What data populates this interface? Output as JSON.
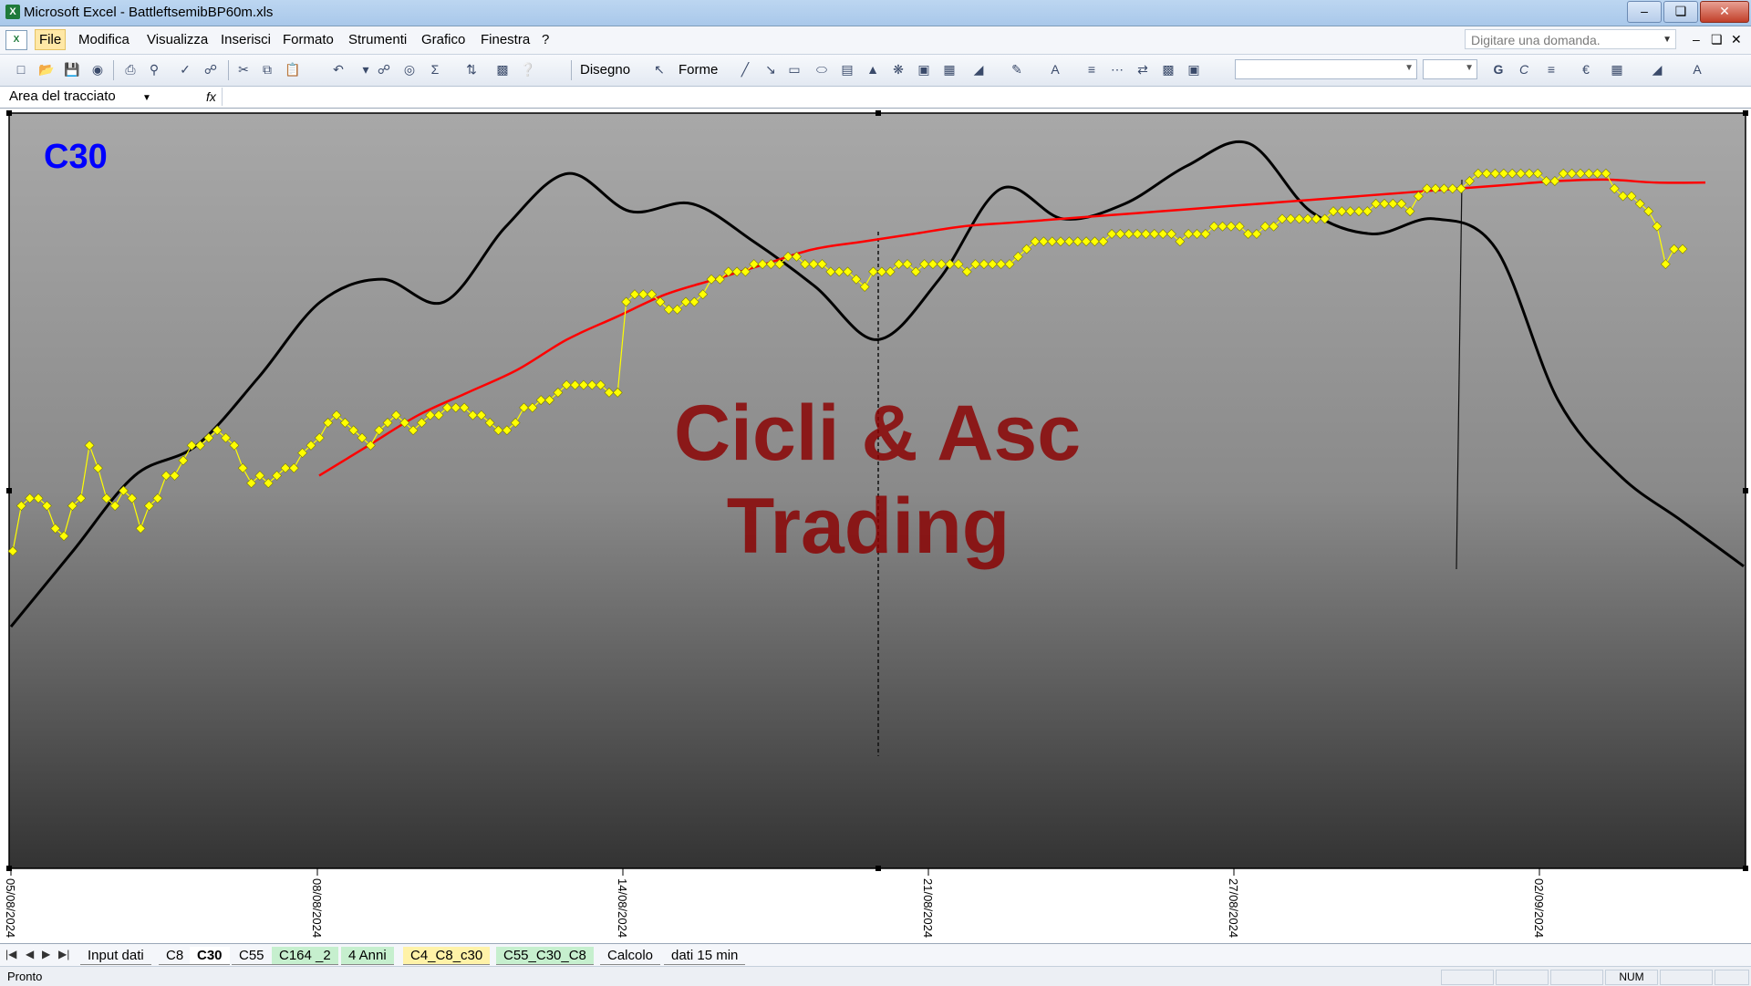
{
  "window": {
    "title": "Microsoft Excel - BattleftsemibBP60m.xls"
  },
  "menu": [
    "File",
    "Modifica",
    "Visualizza",
    "Inserisci",
    "Formato",
    "Strumenti",
    "Grafico",
    "Finestra",
    "?"
  ],
  "ask_placeholder": "Digitare una domanda.",
  "toolbar": {
    "draw_label": "Disegno",
    "shapes_label": "Forme"
  },
  "namebox": {
    "value": "Area del tracciato",
    "fx": "fx"
  },
  "chart_data": {
    "type": "line",
    "title": "C30",
    "watermark": [
      "Cicli & Asc",
      "Trading"
    ],
    "x_tick_labels": [
      "05/08/2024",
      "08/08/2024",
      "14/08/2024",
      "21/08/2024",
      "27/08/2024",
      "02/09/2024"
    ],
    "colors": {
      "price": "#ffff00",
      "trend": "#ff0000",
      "cycle": "#000000",
      "title": "#0000ff",
      "watermark": "#8b0000"
    },
    "series": [
      {
        "key": "price",
        "values": [
          42,
          48,
          49,
          49,
          48,
          45,
          44,
          48,
          49,
          56,
          53,
          49,
          48,
          50,
          49,
          45,
          48,
          49,
          52,
          52,
          54,
          56,
          56,
          57,
          58,
          57,
          56,
          53,
          51,
          52,
          51,
          52,
          53,
          53,
          55,
          56,
          57,
          59,
          60,
          59,
          58,
          57,
          56,
          58,
          59,
          60,
          59,
          58,
          59,
          60,
          60,
          61,
          61,
          61,
          60,
          60,
          59,
          58,
          58,
          59,
          61,
          61,
          62,
          62,
          63,
          64,
          64,
          64,
          64,
          64,
          63,
          63,
          75,
          76,
          76,
          76,
          75,
          74,
          74,
          75,
          75,
          76,
          78,
          78,
          79,
          79,
          79,
          80,
          80,
          80,
          80,
          81,
          81,
          80,
          80,
          80,
          79,
          79,
          79,
          78,
          77,
          79,
          79,
          79,
          80,
          80,
          79,
          80,
          80,
          80,
          80,
          80,
          79,
          80,
          80,
          80,
          80,
          80,
          81,
          82,
          83,
          83,
          83,
          83,
          83,
          83,
          83,
          83,
          83,
          84,
          84,
          84,
          84,
          84,
          84,
          84,
          84,
          83,
          84,
          84,
          84,
          85,
          85,
          85,
          85,
          84,
          84,
          85,
          85,
          86,
          86,
          86,
          86,
          86,
          86,
          87,
          87,
          87,
          87,
          87,
          88,
          88,
          88,
          88,
          87,
          89,
          90,
          90,
          90,
          90,
          90,
          91,
          92,
          92,
          92,
          92,
          92,
          92,
          92,
          92,
          91,
          91,
          92,
          92,
          92,
          92,
          92,
          92,
          90,
          89,
          89,
          88,
          87,
          85,
          80,
          82,
          82
        ]
      },
      {
        "key": "trend",
        "values": [
          52,
          56,
          60,
          63,
          66,
          70,
          73,
          76,
          78,
          80,
          82,
          83,
          84,
          85,
          85.5,
          86,
          86.5,
          87,
          87.5,
          88,
          88.5,
          89,
          89.5,
          90,
          90.5,
          91,
          91.2,
          90.8,
          90.8
        ]
      },
      {
        "key": "cycle",
        "values": [
          32,
          42,
          52,
          56,
          65,
          75,
          78,
          75,
          85,
          92,
          87,
          88,
          83,
          77,
          70,
          78,
          90,
          86,
          88,
          93,
          96,
          87,
          84,
          86,
          82,
          62,
          52,
          46,
          40
        ]
      }
    ]
  },
  "sheets": [
    "Input dati",
    "C8",
    "C30",
    "C55",
    "C164 _2",
    "4 Anni",
    "C4_C8_c30",
    "C55_C30_C8",
    "Calcolo",
    "dati 15 min"
  ],
  "active_sheet": "C30",
  "status": {
    "text": "Pronto",
    "num": "NUM"
  }
}
